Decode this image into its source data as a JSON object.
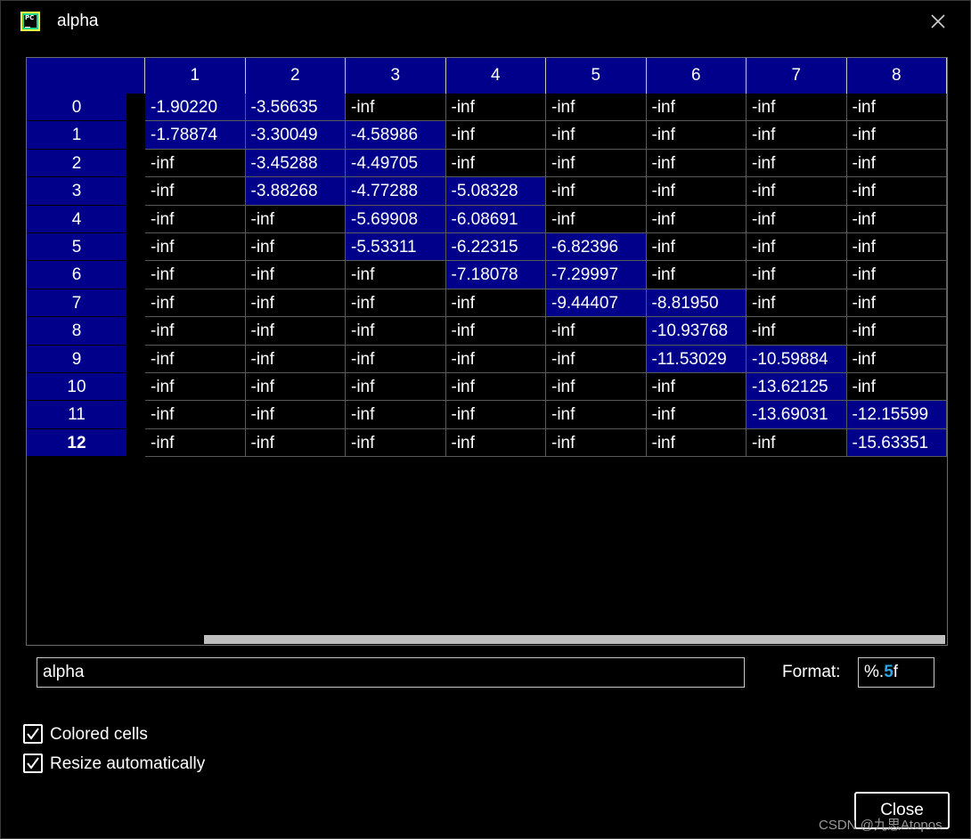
{
  "window": {
    "title": "alpha",
    "icon": "pycharm-icon",
    "icon_text": "PC"
  },
  "table": {
    "columns": [
      "1",
      "2",
      "3",
      "4",
      "5",
      "6",
      "7",
      "8"
    ],
    "rows": [
      {
        "label": "0",
        "bold": false,
        "cells": [
          "-1.90220",
          "-3.56635",
          "-inf",
          "-inf",
          "-inf",
          "-inf",
          "-inf",
          "-inf"
        ],
        "highlight": [
          0,
          1
        ]
      },
      {
        "label": "1",
        "bold": false,
        "cells": [
          "-1.78874",
          "-3.30049",
          "-4.58986",
          "-inf",
          "-inf",
          "-inf",
          "-inf",
          "-inf"
        ],
        "highlight": [
          0,
          1,
          2
        ]
      },
      {
        "label": "2",
        "bold": false,
        "cells": [
          "-inf",
          "-3.45288",
          "-4.49705",
          "-inf",
          "-inf",
          "-inf",
          "-inf",
          "-inf"
        ],
        "highlight": [
          1,
          2
        ]
      },
      {
        "label": "3",
        "bold": false,
        "cells": [
          "-inf",
          "-3.88268",
          "-4.77288",
          "-5.08328",
          "-inf",
          "-inf",
          "-inf",
          "-inf"
        ],
        "highlight": [
          1,
          2,
          3
        ]
      },
      {
        "label": "4",
        "bold": false,
        "cells": [
          "-inf",
          "-inf",
          "-5.69908",
          "-6.08691",
          "-inf",
          "-inf",
          "-inf",
          "-inf"
        ],
        "highlight": [
          2,
          3
        ]
      },
      {
        "label": "5",
        "bold": false,
        "cells": [
          "-inf",
          "-inf",
          "-5.53311",
          "-6.22315",
          "-6.82396",
          "-inf",
          "-inf",
          "-inf"
        ],
        "highlight": [
          2,
          3,
          4
        ]
      },
      {
        "label": "6",
        "bold": false,
        "cells": [
          "-inf",
          "-inf",
          "-inf",
          "-7.18078",
          "-7.29997",
          "-inf",
          "-inf",
          "-inf"
        ],
        "highlight": [
          3,
          4
        ]
      },
      {
        "label": "7",
        "bold": false,
        "cells": [
          "-inf",
          "-inf",
          "-inf",
          "-inf",
          "-9.44407",
          "-8.81950",
          "-inf",
          "-inf"
        ],
        "highlight": [
          4,
          5
        ]
      },
      {
        "label": "8",
        "bold": false,
        "cells": [
          "-inf",
          "-inf",
          "-inf",
          "-inf",
          "-inf",
          "-10.93768",
          "-inf",
          "-inf"
        ],
        "highlight": [
          5
        ]
      },
      {
        "label": "9",
        "bold": false,
        "cells": [
          "-inf",
          "-inf",
          "-inf",
          "-inf",
          "-inf",
          "-11.53029",
          "-10.59884",
          "-inf"
        ],
        "highlight": [
          5,
          6
        ]
      },
      {
        "label": "10",
        "bold": false,
        "cells": [
          "-inf",
          "-inf",
          "-inf",
          "-inf",
          "-inf",
          "-inf",
          "-13.62125",
          "-inf"
        ],
        "highlight": [
          6
        ]
      },
      {
        "label": "11",
        "bold": false,
        "cells": [
          "-inf",
          "-inf",
          "-inf",
          "-inf",
          "-inf",
          "-inf",
          "-13.69031",
          "-12.15599"
        ],
        "highlight": [
          6,
          7
        ]
      },
      {
        "label": "12",
        "bold": true,
        "cells": [
          "-inf",
          "-inf",
          "-inf",
          "-inf",
          "-inf",
          "-inf",
          "-inf",
          "-15.63351"
        ],
        "highlight": [
          7
        ]
      }
    ],
    "header_bg": "#00008b",
    "highlight_bg": "#00008b",
    "scrollbar_position": 0.19
  },
  "controls": {
    "name_value": "alpha",
    "format_label": "Format:",
    "format_prefix": "%.",
    "format_precision": "5",
    "format_suffix": "f",
    "colored_cells_label": "Colored cells",
    "colored_cells_checked": true,
    "resize_label": "Resize automatically",
    "resize_checked": true,
    "close_label": "Close"
  },
  "watermark": "CSDN @九思Atopos"
}
